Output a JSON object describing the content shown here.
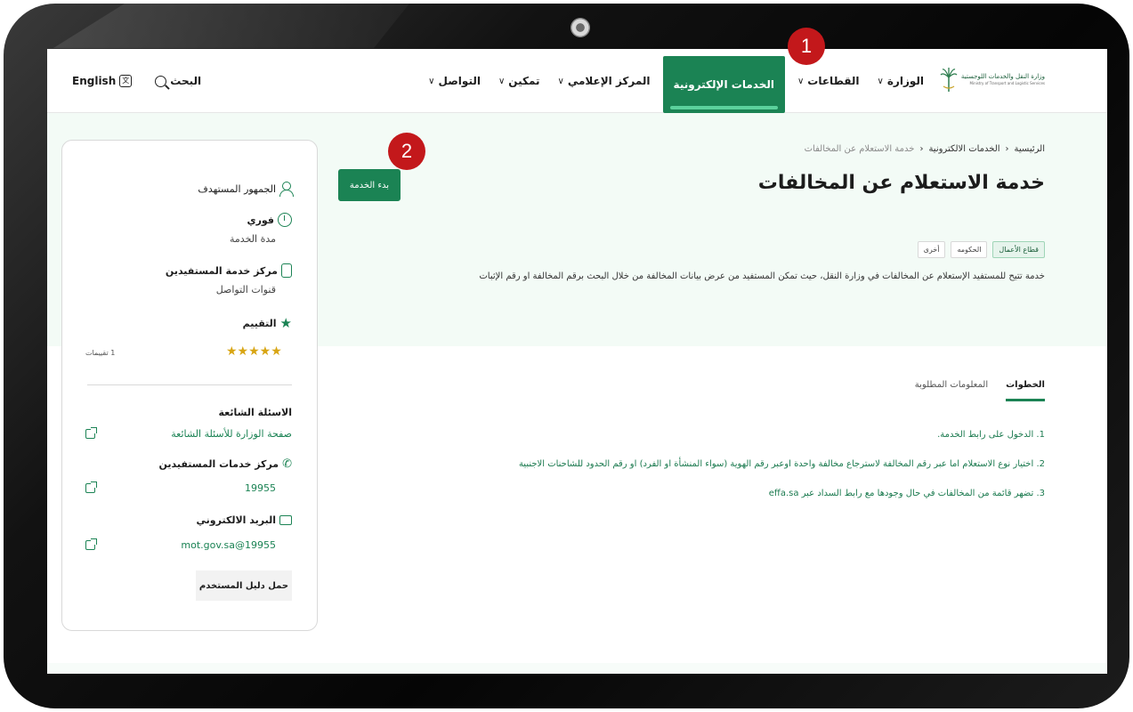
{
  "header": {
    "logo": {
      "name_ar": "وزارة النقل والخدمات اللوجستية",
      "name_en": "Ministry of Transport and Logistic Services"
    },
    "nav": [
      {
        "label": "الوزارة",
        "has_dropdown": true
      },
      {
        "label": "القطاعات",
        "has_dropdown": true
      },
      {
        "label": "الخدمات الإلكترونية",
        "has_dropdown": false,
        "active": true
      },
      {
        "label": "المركز الإعلامي",
        "has_dropdown": true
      },
      {
        "label": "تمكين",
        "has_dropdown": true
      },
      {
        "label": "التواصل",
        "has_dropdown": true
      }
    ],
    "search_label": "البحث",
    "language_label": "English"
  },
  "breadcrumb": {
    "home": "الرئيسية",
    "section": "الخدمات الالكترونية",
    "current": "خدمة الاستعلام عن المخالفات"
  },
  "service": {
    "title": "خدمة الاستعلام عن المخالفات",
    "start_button": "بدء الخدمة",
    "tags": [
      "قطاع الأعمال",
      "الحكومه",
      "أخرى"
    ],
    "description": "خدمة تتيح للمستفيد الإستعلام عن المخالفات في وزارة النقل، حيث تمكن المستفيد من عرض بيانات المخالفة من خلال البحث برقم المخالفة او رقم الإثبات"
  },
  "tabs": [
    {
      "label": "الخطوات",
      "active": true
    },
    {
      "label": "المعلومات المطلوبة",
      "active": false
    }
  ],
  "steps": [
    "1. الدخول على رابط الخدمة.",
    "2. اختيار نوع الاستعلام اما عبر رقم المخالفة لاسترجاع مخالفة واحدة اوعبر رقم الهوية (سواء المنشأة او الفرد) او رقم الحدود للشاحنات الاجنبية",
    "3. تضهر قائمة من المخالفات في حال وجودها مع رابط السداد عبر effa.sa"
  ],
  "sidebar": {
    "audience_label": "الجمهور المستهدف",
    "duration_value": "فوري",
    "duration_label": "مدة الخدمة",
    "channel_value": "مركز خدمة المستفيدين",
    "channel_label": "قنوات التواصل",
    "rating_label": "التقييم",
    "rating_stars": "★★★★★",
    "rating_value": 5,
    "rating_count": "1 تقييمات",
    "faq_title": "الاسئلة الشائعة",
    "faq_link": "صفحة الوزارة للأسئلة الشائعة",
    "support_title": "مركز خدمات المستفيدين",
    "support_number": "19955",
    "email_title": "البريد الالكتروني",
    "email_value": "19955@mot.gov.sa",
    "guide_button": "حمل دليل المستخدم"
  },
  "callouts": [
    "1",
    "2"
  ],
  "colors": {
    "primary": "#1b8354",
    "hero_bg": "#f3fbf6",
    "callout": "#c3181b",
    "star": "#d8a514"
  }
}
